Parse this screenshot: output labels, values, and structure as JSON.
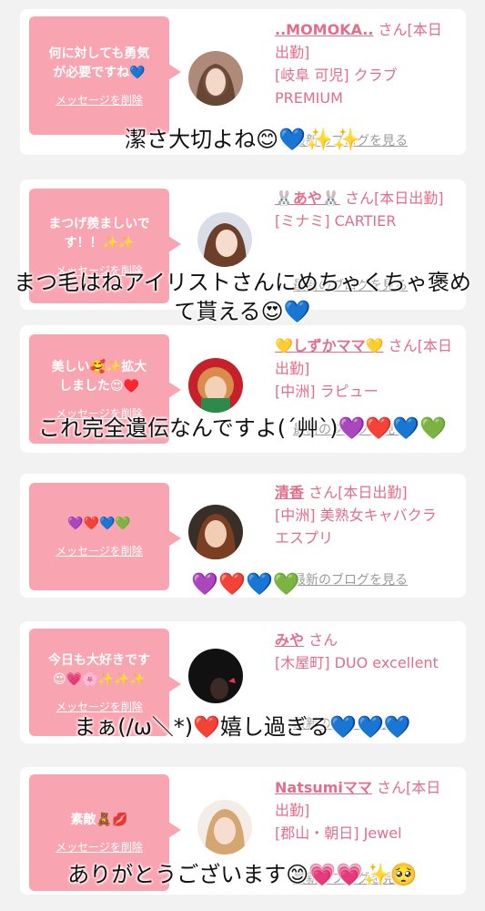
{
  "cards": [
    {
      "message": "何に対しても勇気\nが必要ですね💙",
      "delete_label": "メッセージを削除",
      "avatar": "woman-brown-hair-photo",
      "name": "..MOMOKA..",
      "san_suffix": "さん[本日出勤]",
      "store": "[岐阜 可児] クラブPREMIUM",
      "blog_label": "最新のブログを見る"
    },
    {
      "message": "まつげ羨ましいで\nす！！✨✨",
      "delete_label": "メッセージを削除",
      "avatar": "woman-star-photo",
      "name": "🐰あや🐰",
      "san_suffix": "さん[本日出勤]",
      "store": "[ミナミ] CARTIER",
      "blog_label": "最新のブログを見る"
    },
    {
      "message": "美しい🥰✨拡大\nしました😍♥️",
      "delete_label": "メッセージを削除",
      "avatar": "woman-red-background-photo",
      "name": "💛しずかママ💛",
      "san_suffix": "さん[本日出勤]",
      "store": "[中洲] ラピュー",
      "blog_label": "最新のブログを見る"
    },
    {
      "message": "💜❤️💙💚",
      "delete_label": "メッセージを削除",
      "avatar": "woman-long-hair-photo",
      "name": "清香",
      "san_suffix": "さん[本日出勤]",
      "store": "[中洲] 美熟女キャバクラ エスプリ",
      "blog_label": "最新のブログを見る"
    },
    {
      "message": "今日も大好きです\n😍💗🌸✨✨✨",
      "delete_label": "メッセージを削除",
      "avatar": "woman-dark-photo",
      "name": "みや",
      "san_suffix": "さん",
      "store": "[木屋町] DUO excellent",
      "blog_label": "最新のブログを見る"
    },
    {
      "message": "素敵🧸💋",
      "delete_label": "メッセージを削除",
      "avatar": "woman-blonde-photo",
      "name": "Natsumiママ",
      "san_suffix": "さん[本日出勤]",
      "store": "[郡山・朝日] Jewel",
      "blog_label": "最新のブログを見る"
    }
  ],
  "overlays": [
    "潔さ大切よね😊💙✨✨",
    "まつ毛はねアイリストさんにめちゃくちゃ褒めて貰える😍💙",
    "これ完全遺伝なんですよ(´艸`)💜❤️💙💚",
    "💜❤️💙💚",
    "まぁ(/ω＼*)❤️嬉し過ぎる💙💙💙",
    "ありがとうございます😊💗💗✨🥺"
  ],
  "colors": {
    "bubble": "#f9a5b1",
    "name_pink": "#e46d8c",
    "blog_gray": "#9a9a9a",
    "background": "#f2f2f2"
  }
}
